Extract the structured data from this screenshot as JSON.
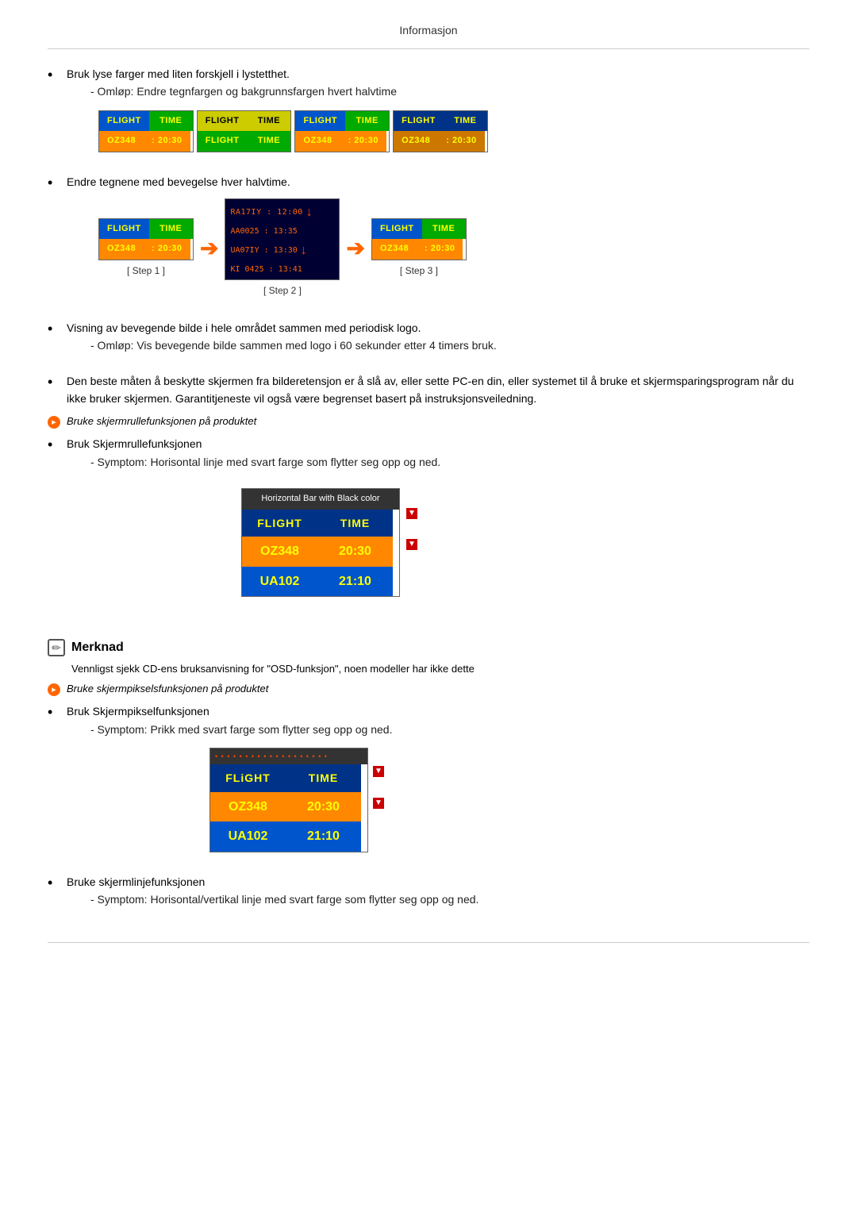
{
  "header": {
    "title": "Informasjon"
  },
  "content": {
    "bullet1": {
      "text": "Bruk lyse farger med liten forskjell i lystetthet.",
      "sub1": "- Omløp: Endre tegnfargen og bakgrunnsfargen hvert halvtime"
    },
    "bullet2": {
      "text": "Endre tegnene med bevegelse hver halvtime."
    },
    "bullet3": {
      "text": "Visning av bevegende bilde i hele området sammen med periodisk logo."
    },
    "bullet3_sub": "- Omløp: Vis bevegende bilde sammen med logo i 60 sekunder etter 4 timers bruk.",
    "bullet4": {
      "text": "Den beste måten å beskytte skjermen fra bilderetensjon er å slå av, eller sette PC-en din, eller systemet til å bruke et skjermsparingsprogram når du ikke bruker skjermen. Garantitjeneste vil også være begrenset basert på instruksjonsveiledning."
    },
    "orange_item1": {
      "text": "Bruke skjermrullefunksjonen på produktet"
    },
    "bullet5": {
      "text": "Bruk Skjermrullefunksjonen"
    },
    "bullet5_sub": "- Symptom: Horisontal linje med svart farge som flytter seg opp og ned.",
    "hbar_title": "Horizontal Bar with Black color",
    "hbar_r1c1": "FLIGHT",
    "hbar_r1c2": "TIME",
    "hbar_r2c1": "OZ348",
    "hbar_r2c2": "20:30",
    "hbar_r3c1": "UA102",
    "hbar_r3c2": "21:10",
    "note_title": "Merknad",
    "note_text": "Vennligst sjekk CD-ens bruksanvisning for \"OSD-funksjon\", noen modeller har ikke dette",
    "orange_item2": {
      "text": "Bruke skjermpikselsfunksjonen på produktet"
    },
    "bullet6": {
      "text": "Bruk Skjermpikselfunksjonen"
    },
    "bullet6_sub": "- Symptom: Prikk med svart farge som flytter seg opp og ned.",
    "pixel_r1c1": "FLiGHT",
    "pixel_r1c2": "TIME",
    "pixel_r2c1": "OZ348",
    "pixel_r2c2": "20:30",
    "pixel_r3c1": "UA102",
    "pixel_r3c2": "21:10",
    "bullet7": {
      "text": "Bruke skjermlinjefunksjonen"
    },
    "bullet7_sub": "- Symptom: Horisontal/vertikal linje med svart farge som flytter seg opp og ned.",
    "diagram1": {
      "boxes": [
        {
          "r1c1": "FLIGHT",
          "r1c2": "TIME",
          "r2c1": "OZ348",
          "r2c2": "20:30",
          "style": "blue-yellow"
        },
        {
          "r1c1": "FLIGHT",
          "r1c2": "TIME",
          "r2c1": "FLIGHT",
          "r2c2": "TIME",
          "style": "green-orange"
        },
        {
          "r1c1": "FLIGHT",
          "r1c2": "TIME",
          "r2c1": "OZ348",
          "r2c2": "20:30",
          "style": "blue-yellow"
        },
        {
          "r1c1": "FLIGHT",
          "r1c2": "TIME",
          "r2c1": "OZ348",
          "r2c2": "20:30",
          "style": "plain"
        }
      ]
    },
    "step1_label": "[ Step 1 ]",
    "step2_label": "[ Step 2 ]",
    "step3_label": "[ Step 3 ]",
    "step1_r1c1": "FLIGHT",
    "step1_r1c2": "TIME",
    "step1_r2c1": "OZ348",
    "step1_r2c2": "20:30",
    "step2_r1": "RA17IY : 12:00",
    "step2_r1b": "AA0025 : 13:35",
    "step2_r2": "UA07IY : 13:30",
    "step2_r2b": "KI 0425 : 13:41",
    "step3_r1c1": "FLIGHT",
    "step3_r1c2": "TIME",
    "step3_r2c1": "OZ348",
    "step3_r2c2": "20:30"
  }
}
